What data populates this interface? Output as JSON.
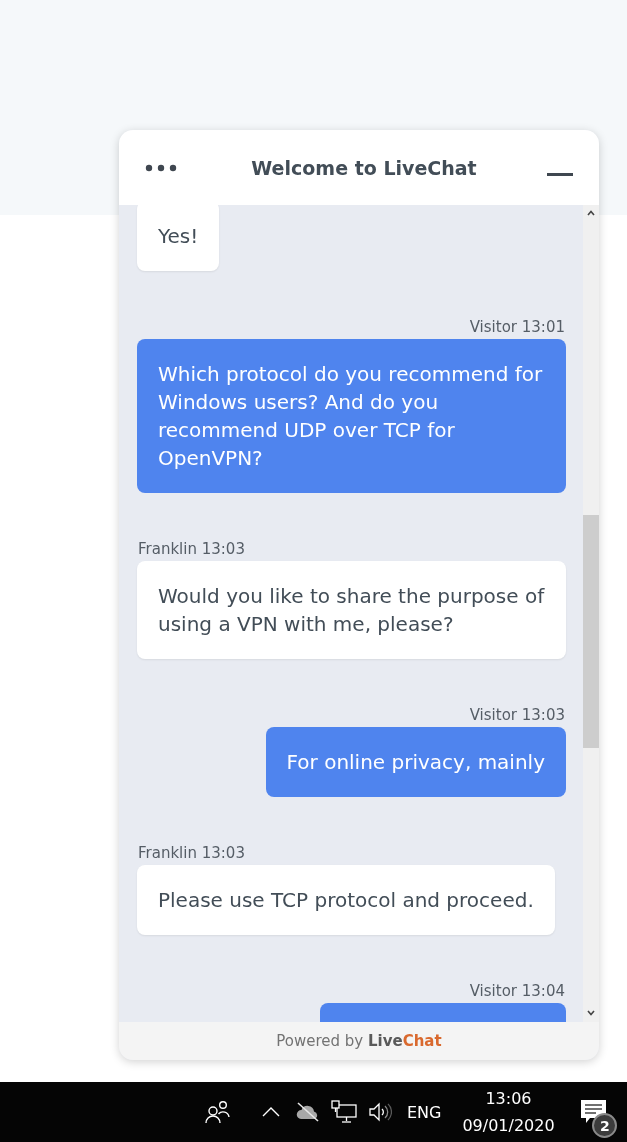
{
  "chat_window": {
    "title": "Welcome to LiveChat",
    "messages": [
      {
        "kind": "agent",
        "text": "Yes!"
      },
      {
        "kind": "visitor",
        "meta": "Visitor 13:01",
        "text": "Which protocol do you recommend for Windows users? And do you recommend UDP over TCP for OpenVPN?"
      },
      {
        "kind": "agent",
        "meta": "Franklin 13:03",
        "text": "Would you like to share the purpose of using a VPN with me, please?"
      },
      {
        "kind": "visitor",
        "meta": "Visitor 13:03",
        "text": "For online privacy, mainly"
      },
      {
        "kind": "agent",
        "meta": "Franklin 13:03",
        "text": "Please use TCP protocol and proceed."
      },
      {
        "kind": "visitor",
        "meta": "Visitor 13:04"
      }
    ],
    "footer": {
      "prefix": "Powered by",
      "brand": [
        "Live",
        "Chat"
      ]
    }
  },
  "taskbar": {
    "language": "ENG",
    "time": "13:06",
    "date": "09/01/2020",
    "notification_count": "2"
  }
}
